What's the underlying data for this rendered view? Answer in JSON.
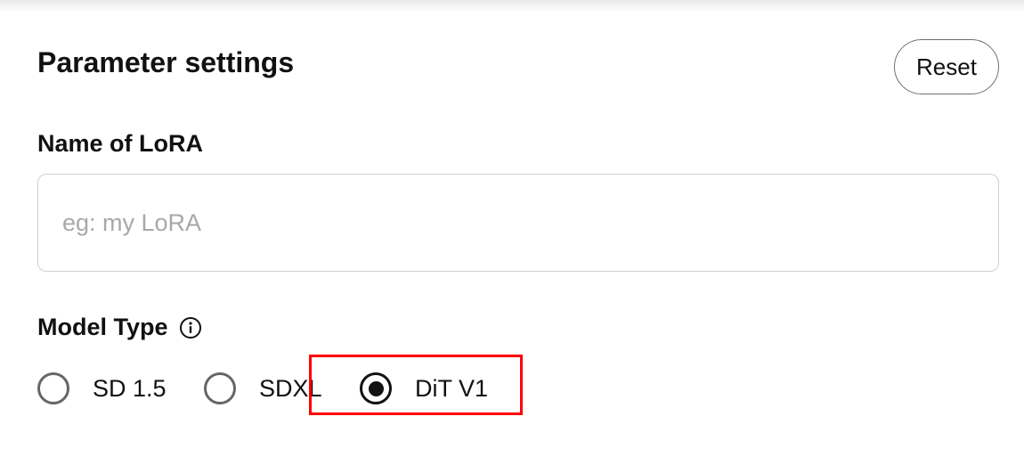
{
  "panel": {
    "title": "Parameter settings",
    "reset_label": "Reset"
  },
  "lora_name": {
    "label": "Name of LoRA",
    "value": "",
    "placeholder": "eg: my LoRA"
  },
  "model_type": {
    "label": "Model Type",
    "info_icon": "info-circle-icon",
    "options": [
      {
        "label": "SD 1.5",
        "selected": false
      },
      {
        "label": "SDXL",
        "selected": false
      },
      {
        "label": "DiT V1",
        "selected": true
      }
    ]
  },
  "colors": {
    "highlight": "#ff0000",
    "text": "#111111",
    "placeholder": "#a8a8a8",
    "input_border": "#cfcfcf"
  }
}
